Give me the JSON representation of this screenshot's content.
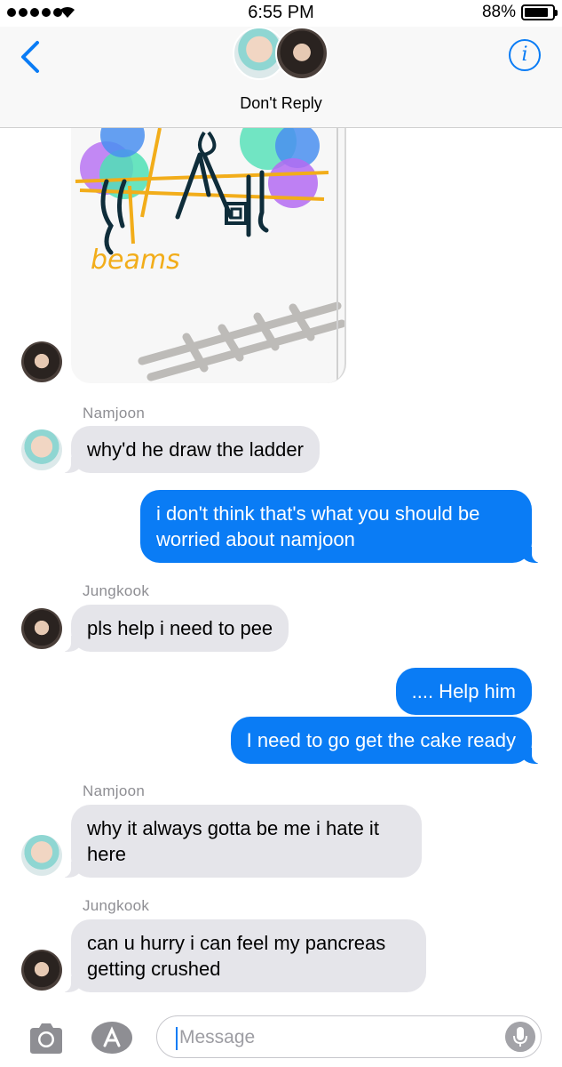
{
  "status_bar": {
    "time": "6:55 PM",
    "battery": "88%"
  },
  "header": {
    "group_name": "Don't Reply",
    "back_icon": "chevron-left-icon",
    "info_icon": "info-icon",
    "info_glyph": "i"
  },
  "drawing": {
    "label": "beams"
  },
  "messages": [
    {
      "sender": "Namjoon",
      "text": "why'd he draw the ladder",
      "direction": "incoming"
    },
    {
      "text": "i don't think that's what you should be worried about namjoon",
      "direction": "outgoing"
    },
    {
      "sender": "Jungkook",
      "text": "pls help i need to pee",
      "direction": "incoming"
    },
    {
      "text": ".... Help him",
      "direction": "outgoing"
    },
    {
      "text": "I need to go get the cake ready",
      "direction": "outgoing"
    },
    {
      "sender": "Namjoon",
      "text": "why it always gotta be me i hate it here",
      "direction": "incoming"
    },
    {
      "sender": "Jungkook",
      "text": "can u hurry i can feel my pancreas getting crushed",
      "direction": "incoming"
    }
  ],
  "input": {
    "placeholder": "Message",
    "camera_icon": "camera-icon",
    "apps_icon": "app-store-icon",
    "mic_icon": "microphone-icon"
  },
  "colors": {
    "accent": "#0a7cf5",
    "incoming_bubble": "#e5e5ea",
    "sender_label": "#8e8e93"
  }
}
